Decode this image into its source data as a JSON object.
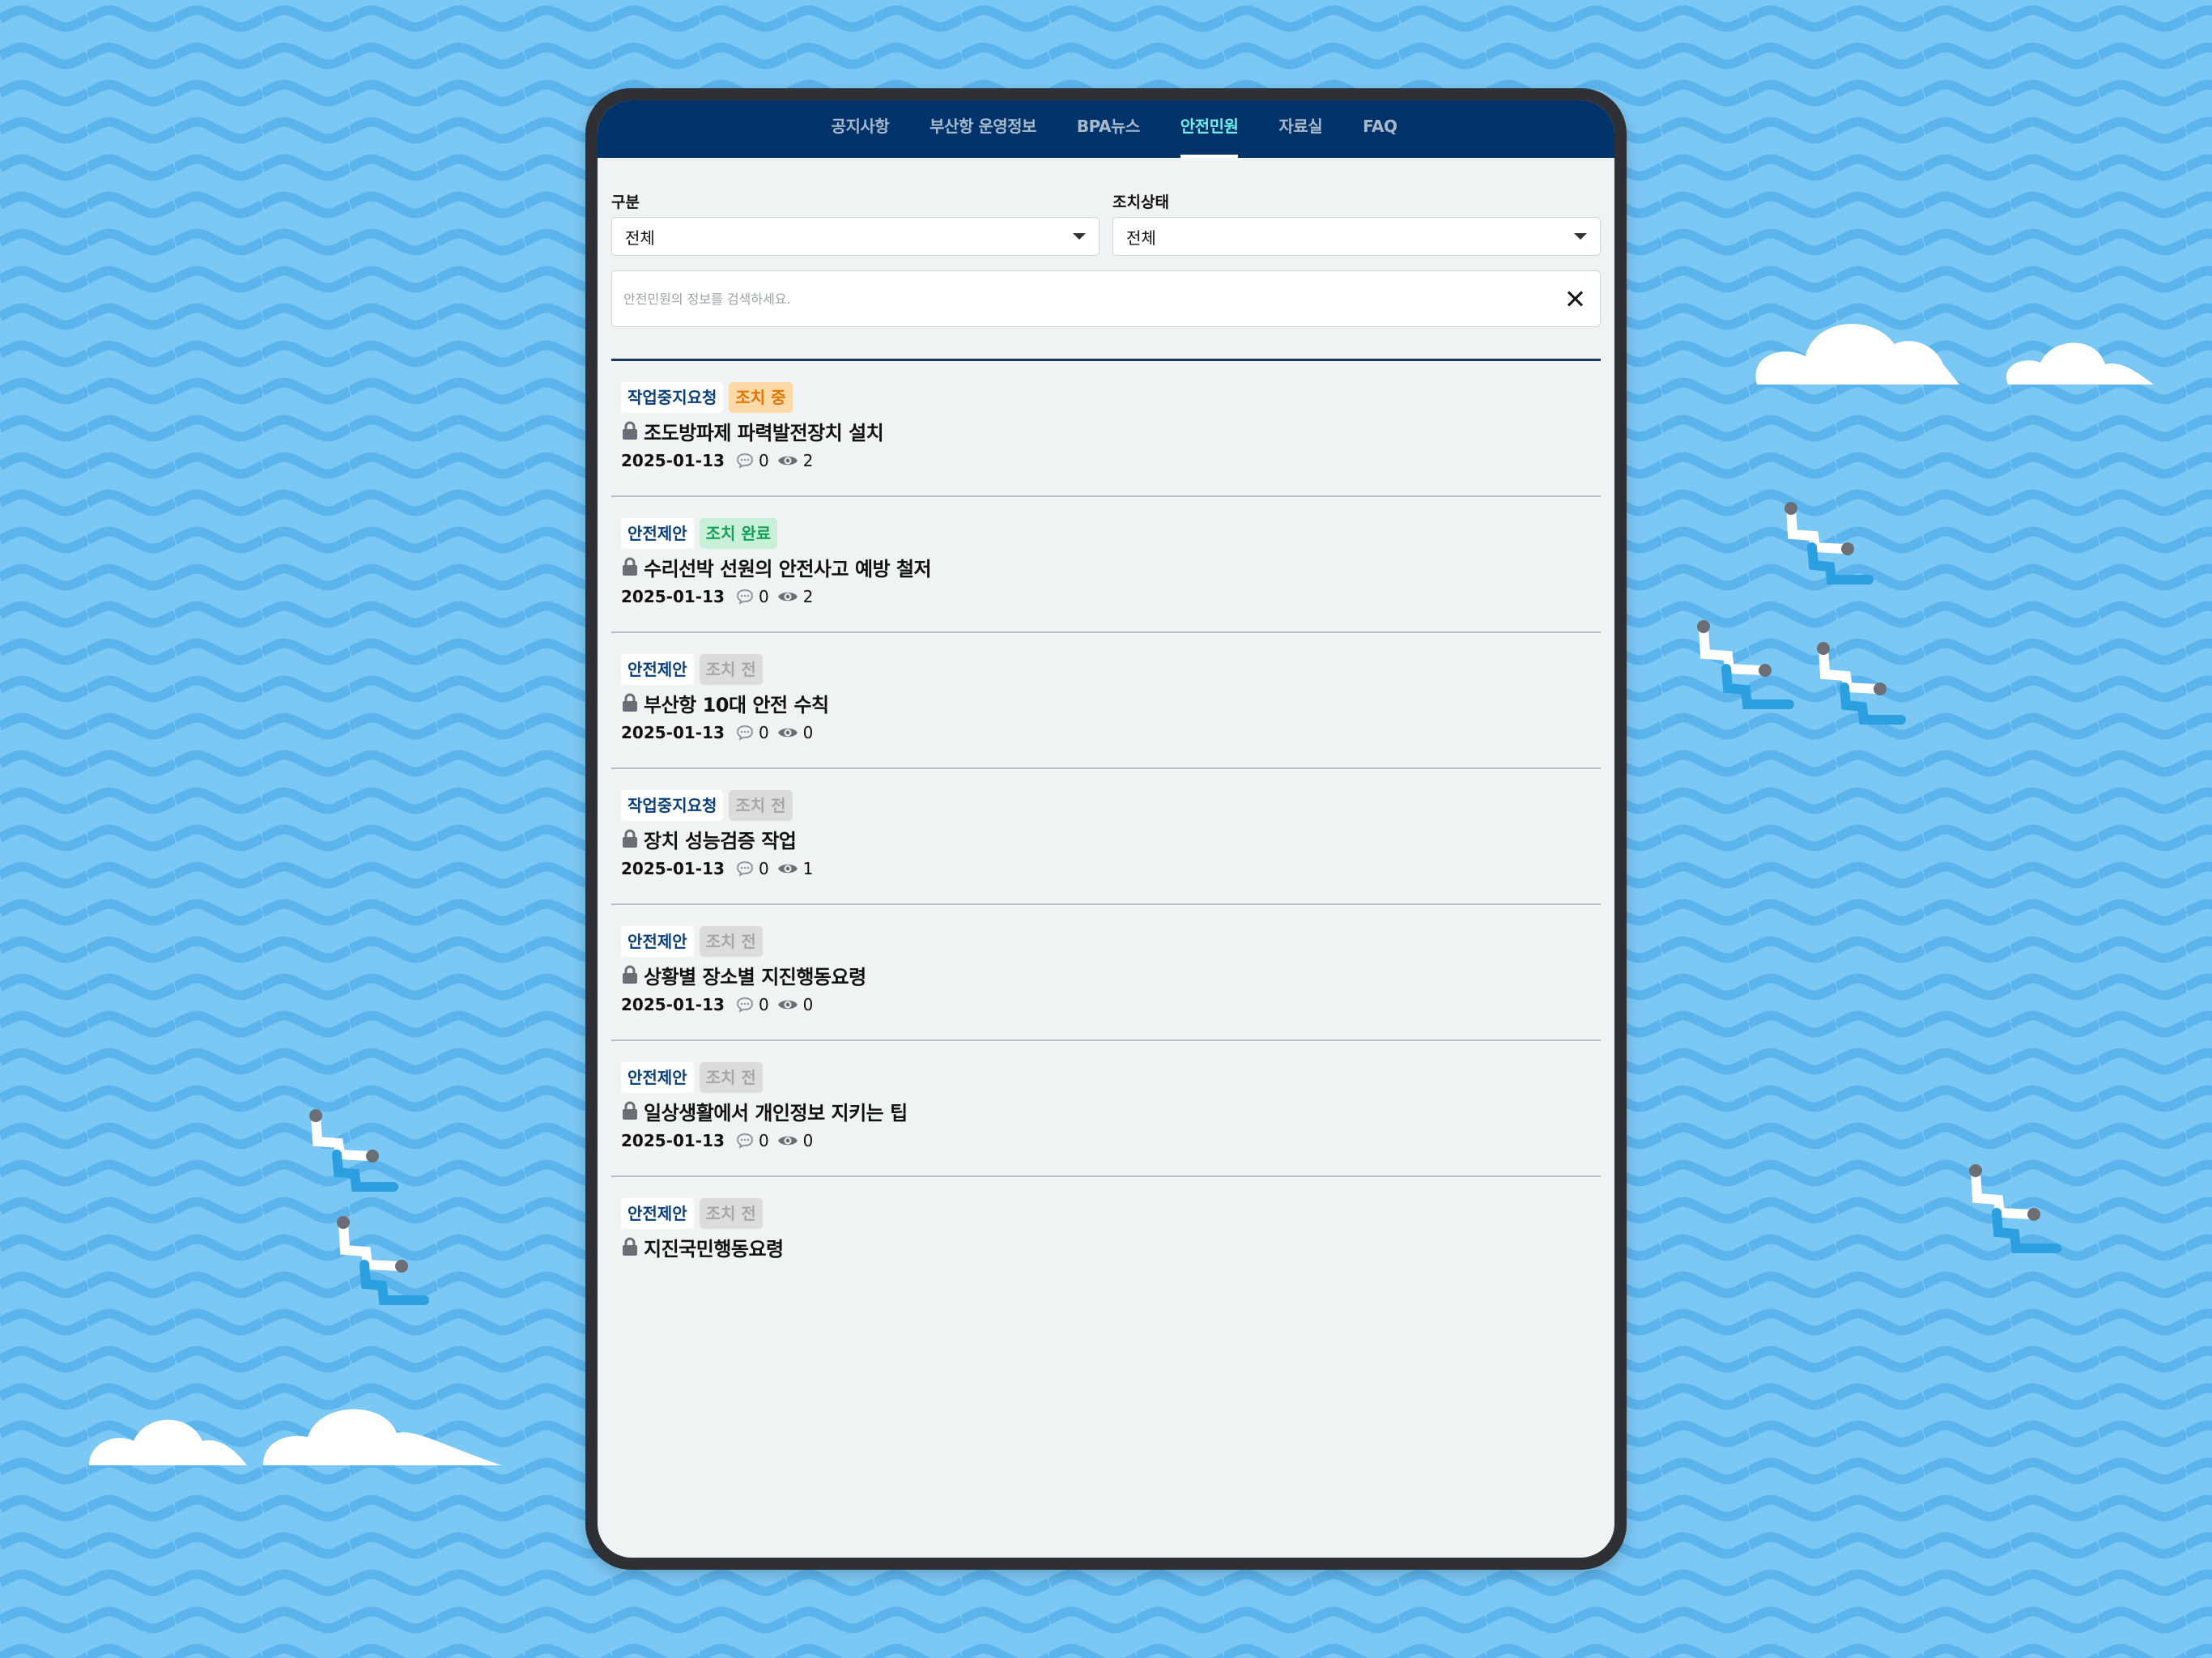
{
  "nav": {
    "tabs": [
      {
        "label": "공지사항"
      },
      {
        "label": "부산항 운영정보"
      },
      {
        "label": "BPA뉴스"
      },
      {
        "label": "안전민원"
      },
      {
        "label": "자료실"
      },
      {
        "label": "FAQ"
      }
    ],
    "active_index": 3
  },
  "filters": {
    "category": {
      "label": "구분",
      "value": "전체"
    },
    "status": {
      "label": "조치상태",
      "value": "전체"
    }
  },
  "search": {
    "placeholder": "안전민원의 정보를 검색하세요.",
    "value": ""
  },
  "icons": {
    "lock": "lock-icon",
    "comment": "comment-icon",
    "views": "eye-icon",
    "clear": "close-icon",
    "dropdown": "chevron-down-icon"
  },
  "colors": {
    "nav_bg": "#003369",
    "active_tab": "#6ff0ec",
    "status_in_progress": "#e07507",
    "status_done": "#15a05a",
    "status_pending": "#a6a6a6"
  },
  "items": [
    {
      "category": "작업중지요청",
      "status": "조치 중",
      "title": "조도방파제 파력발전장치 설치",
      "date": "2025-01-13",
      "comments": "0",
      "views": "2"
    },
    {
      "category": "안전제안",
      "status": "조치 완료",
      "title": "수리선박 선원의 안전사고 예방 철저",
      "date": "2025-01-13",
      "comments": "0",
      "views": "2"
    },
    {
      "category": "안전제안",
      "status": "조치 전",
      "title": "부산항 10대 안전 수칙",
      "date": "2025-01-13",
      "comments": "0",
      "views": "0"
    },
    {
      "category": "작업중지요청",
      "status": "조치 전",
      "title": "장치 성능검증 작업",
      "date": "2025-01-13",
      "comments": "0",
      "views": "1"
    },
    {
      "category": "안전제안",
      "status": "조치 전",
      "title": "상황별 장소별 지진행동요령",
      "date": "2025-01-13",
      "comments": "0",
      "views": "0"
    },
    {
      "category": "안전제안",
      "status": "조치 전",
      "title": "일상생활에서 개인정보 지키는 팁",
      "date": "2025-01-13",
      "comments": "0",
      "views": "0"
    },
    {
      "category": "안전제안",
      "status": "조치 전",
      "title": "지진국민행동요령"
    }
  ]
}
